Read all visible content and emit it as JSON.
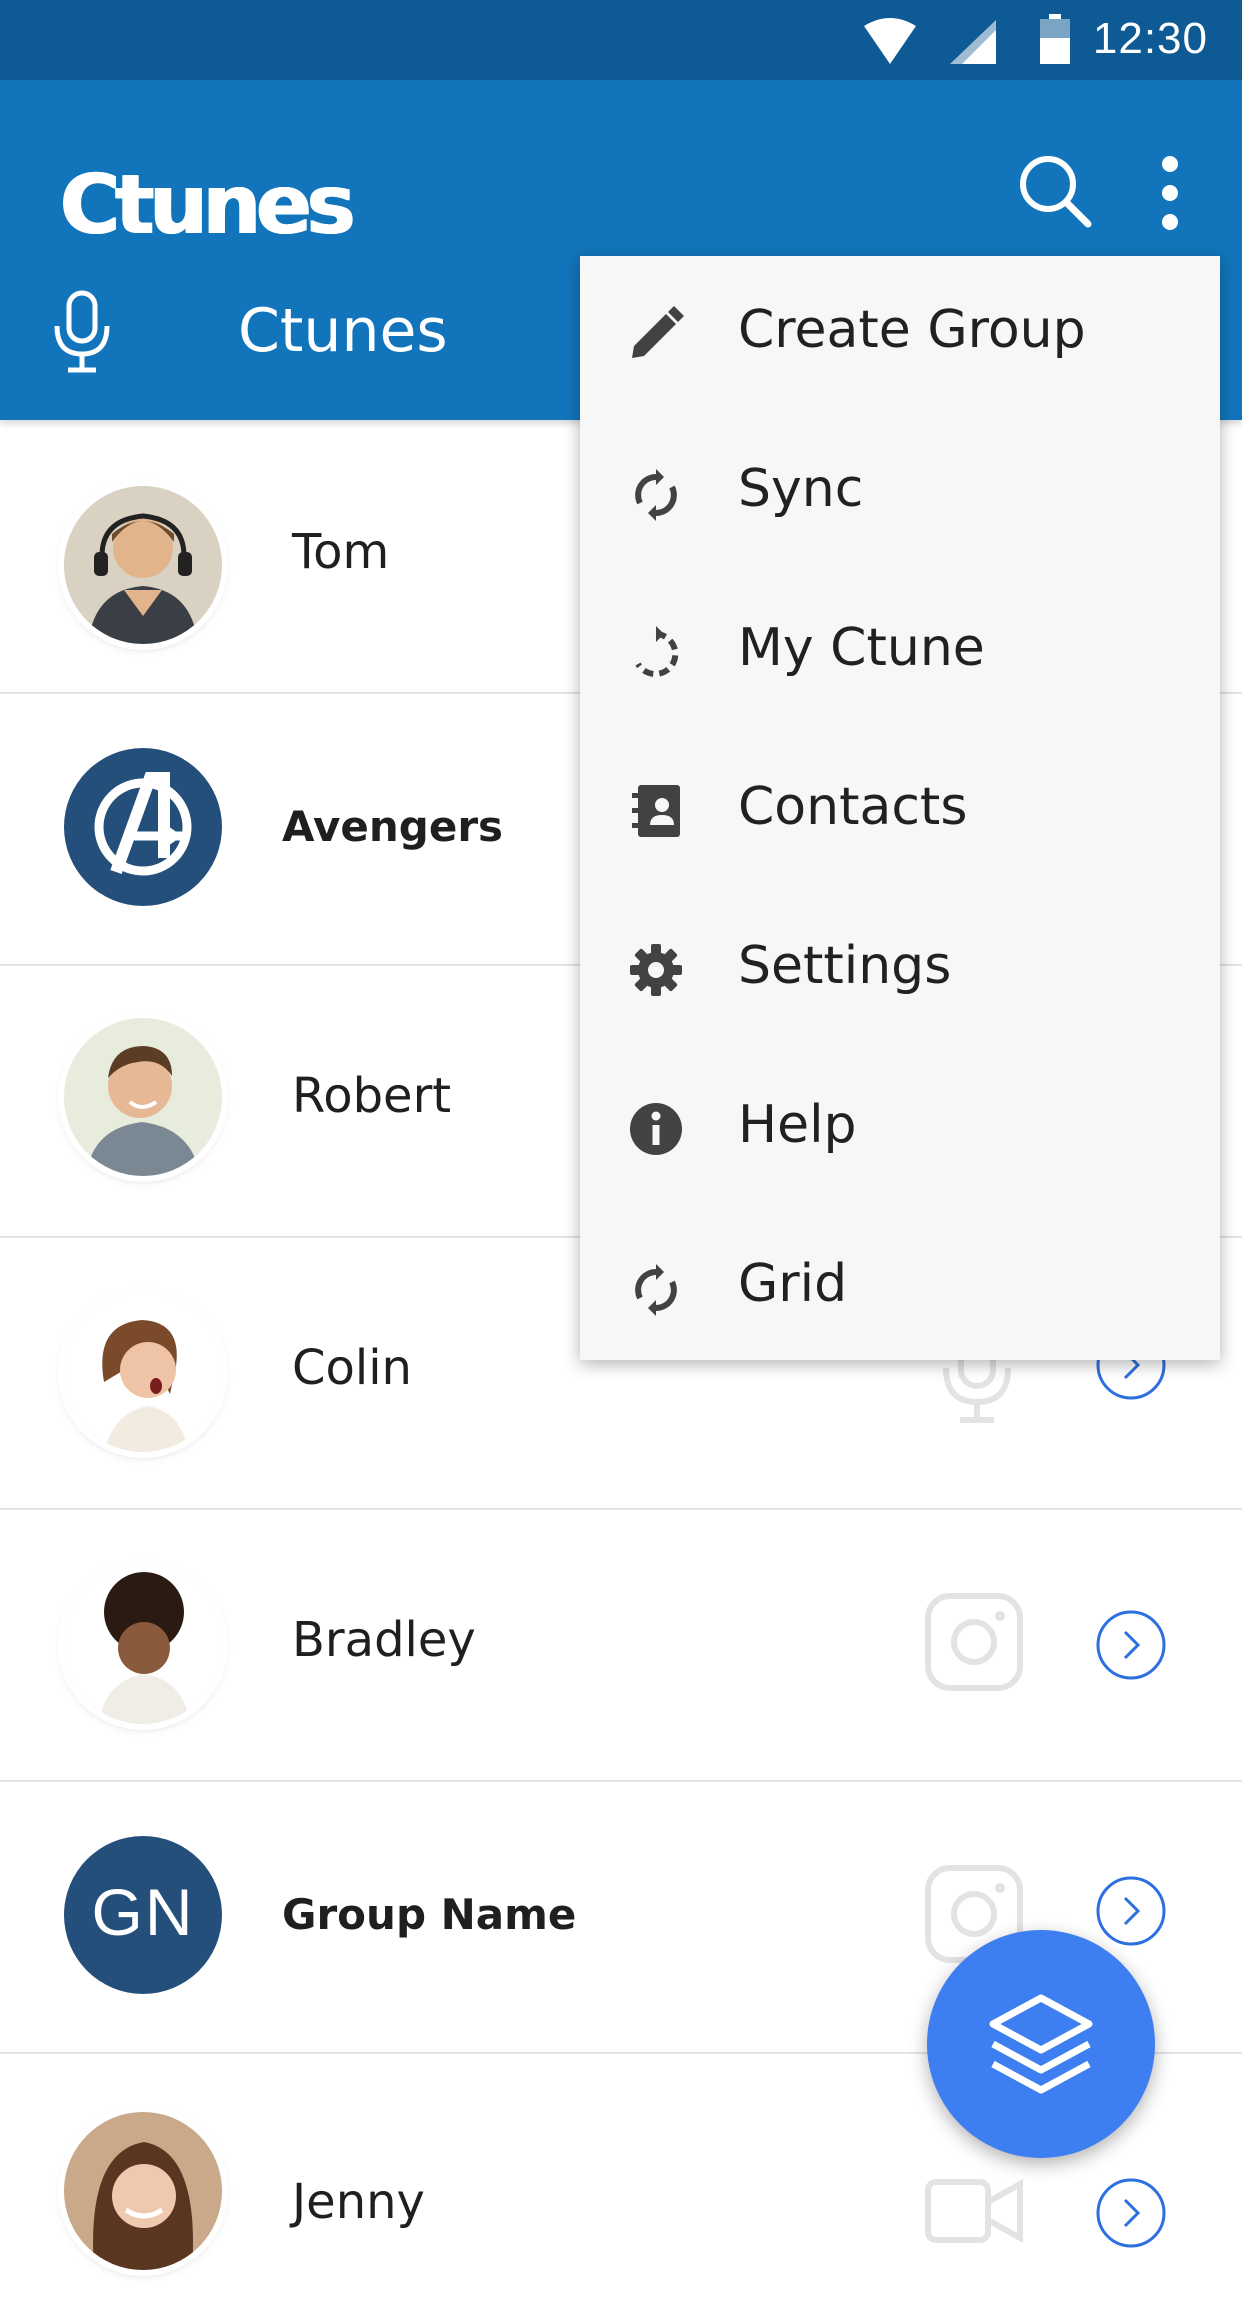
{
  "status_bar": {
    "time": "12:30"
  },
  "app_bar": {
    "logo": "Ctunes",
    "tab_label": "Ctunes",
    "search_icon": "search-icon",
    "overflow_icon": "more-vert-icon"
  },
  "contacts": [
    {
      "name": "Tom",
      "kind": "photo",
      "action_icon": "none"
    },
    {
      "name": "Avengers",
      "kind": "group-logo",
      "action_icon": "none"
    },
    {
      "name": "Robert",
      "kind": "photo",
      "action_icon": "none"
    },
    {
      "name": "Colin",
      "kind": "photo",
      "action_icon": "mic-icon"
    },
    {
      "name": "Bradley",
      "kind": "photo",
      "action_icon": "instagram-icon"
    },
    {
      "name": "Group Name",
      "kind": "initials",
      "initials": "GN",
      "action_icon": "instagram-icon"
    },
    {
      "name": "Jenny",
      "kind": "photo",
      "action_icon": "video-icon"
    }
  ],
  "menu": {
    "items": [
      {
        "label": "Create Group",
        "icon": "pencil-icon"
      },
      {
        "label": "Sync",
        "icon": "sync-icon"
      },
      {
        "label": "My Ctune",
        "icon": "history-icon"
      },
      {
        "label": "Contacts",
        "icon": "contacts-icon"
      },
      {
        "label": "Settings",
        "icon": "gear-icon"
      },
      {
        "label": "Help",
        "icon": "info-icon"
      },
      {
        "label": "Grid",
        "icon": "sync-icon"
      }
    ]
  },
  "fab": {
    "icon": "layers-icon"
  },
  "colors": {
    "status_bar": "#0d5a94",
    "app_bar": "#1275bb",
    "avatar_dark": "#244f7b",
    "fab": "#3d7ff0",
    "arrow_blue": "#2e6fe0"
  }
}
